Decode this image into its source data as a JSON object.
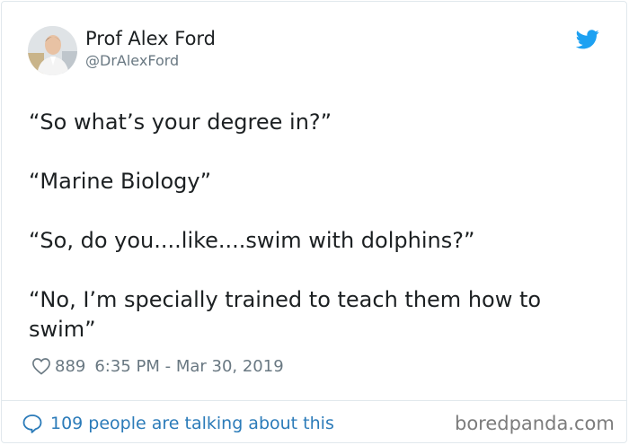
{
  "author": {
    "name": "Prof Alex Ford",
    "handle": "@DrAlexFord"
  },
  "tweet": {
    "paragraphs": [
      "“So what’s your degree in?”",
      "“Marine Biology”",
      "“So, do you....like....swim with dolphins?”",
      "“No, I’m specially trained to teach them how to swim”"
    ],
    "likes": "889",
    "timestamp": "6:35 PM - Mar 30, 2019"
  },
  "footer": {
    "talking_text": "109 people are talking about this",
    "watermark": "boredpanda.com"
  },
  "icons": {
    "twitter": "twitter-bird-icon",
    "heart": "heart-icon",
    "comment": "speech-bubble-icon"
  },
  "colors": {
    "twitter_blue": "#1da1f2",
    "link_blue": "#2b7bb9",
    "secondary_text": "#697882"
  }
}
